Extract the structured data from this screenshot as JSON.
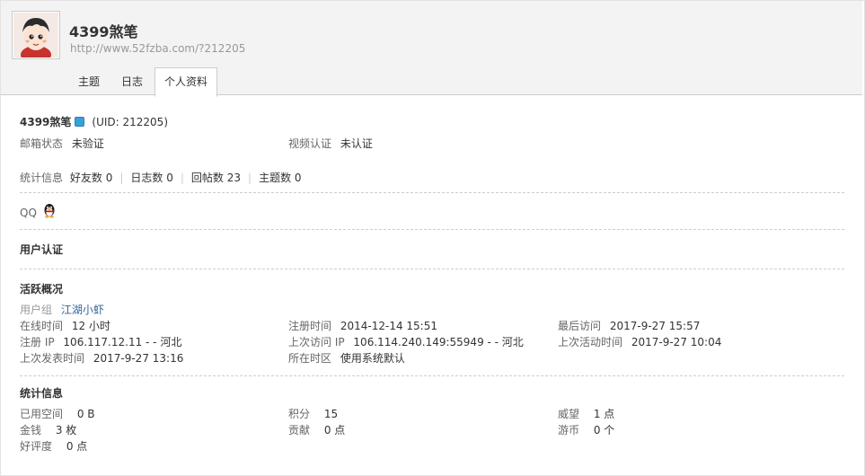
{
  "profile": {
    "name": "4399煞笔",
    "url": "http://www.52fzba.com/?212205",
    "uid_text": "(UID: 212205)"
  },
  "tabs": [
    {
      "label": "主题"
    },
    {
      "label": "日志"
    },
    {
      "label": "个人资料"
    }
  ],
  "verify": {
    "email_label": "邮箱状态",
    "email_value": "未验证",
    "video_label": "视频认证",
    "video_value": "未认证"
  },
  "stats_line": {
    "label": "统计信息",
    "friends_label": "好友数",
    "friends_value": "0",
    "blogs_label": "日志数",
    "blogs_value": "0",
    "replies_label": "回帖数",
    "replies_value": "23",
    "threads_label": "主题数",
    "threads_value": "0",
    "separator": "|"
  },
  "qq": {
    "label": "QQ",
    "icon": "qq-penguin-icon"
  },
  "sections": {
    "user_auth": "用户认证",
    "activity": "活跃概况",
    "statistics": "统计信息"
  },
  "activity": {
    "group_label": "用户组",
    "group_value": "江湖小虾",
    "online_label": "在线时间",
    "online_value": "12 小时",
    "reg_time_label": "注册时间",
    "reg_time_value": "2014-12-14 15:51",
    "last_visit_label": "最后访问",
    "last_visit_value": "2017-9-27 15:57",
    "reg_ip_label": "注册 IP",
    "reg_ip_value": "106.117.12.11 - - 河北",
    "last_ip_label": "上次访问 IP",
    "last_ip_value": "106.114.240.149:55949 - - 河北",
    "last_active_label": "上次活动时间",
    "last_active_value": "2017-9-27 10:04",
    "last_post_label": "上次发表时间",
    "last_post_value": "2017-9-27 13:16",
    "timezone_label": "所在时区",
    "timezone_value": "使用系统默认"
  },
  "statistics": {
    "space_label": "已用空间",
    "space_value": "0 B",
    "credits_label": "积分",
    "credits_value": "15",
    "prestige_label": "威望",
    "prestige_value": "1 点",
    "money_label": "金钱",
    "money_value": "3 枚",
    "contrib_label": "贡献",
    "contrib_value": "0 点",
    "coins_label": "游币",
    "coins_value": "0 个",
    "rating_label": "好评度",
    "rating_value": "0 点"
  },
  "colors": {
    "header_bg": "#f3f3f3",
    "link": "#336699",
    "online_dot": "#3aa1d8",
    "border": "#cdcdcd"
  }
}
